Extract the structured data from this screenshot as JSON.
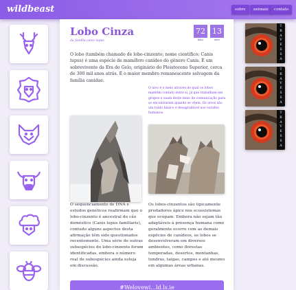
{
  "header": {
    "brand": "wildbeast",
    "nav": [
      "sobre",
      "animais",
      "contato"
    ]
  },
  "rail": {
    "animals": [
      "deer-icon",
      "lion-icon",
      "fox-icon",
      "bull-icon",
      "sheep-icon",
      "bee-icon"
    ]
  },
  "article": {
    "title": "Lobo Cinza",
    "subtitle": "da família canis lupus",
    "stats": [
      {
        "value": "72",
        "label": "kilos"
      },
      {
        "value": "13",
        "label": "anos"
      }
    ],
    "intro": "O lobo (também chamado de lobo-cinzento; nome científico: Canis lupus) é uma espécie de mamífero canídeo do gênero Canis. É um sobrevivente da Era do Gelo, originário do Pleistoceno Superior, cerca de 300 mil anos atrás. É o maior membro remanescente selvagem da família canidae.",
    "quote": "O uivo é o meio através do qual os lobos mantêm contato entre si, já que trabalham em grupos e usam deste meio de comunicação para se encontrarem quando se vêem. Os uivos são um ruído básico e desagradável aos ouvidos humanos.",
    "body_left": "O sequenciamento de DNA e estudos genéticos reafirmam que o lobo-cinzento é ancestral do cão doméstico (Canis lupus familiaris), contudo alguns aspectos desta afirmação têm sido questionados recentemente. Uma série de outras subespécies do lobo-cinzento foram identificadas, embora o número real de subespécies ainda esteja em discussão.",
    "body_right": "Os lobos-cinzentos são tipicamente predadores ápice nos ecossistemas que ocupam. Embora não sejam tão adaptáveis à presença humana como geralmente ocorre com as demais espécies de canídeos, os lobos se desenvolveram em diversos ambientes, como florestas temperadas, desertos, montanhas, tundras, taigas, campos e até mesmo em algumas áreas urbanas.",
    "cta": "#Welovewi...ld.ls.ie"
  },
  "sidebar": {
    "tile_word": [
      "T",
      "R",
      "A",
      "V",
      "E",
      "S",
      "S",
      "A"
    ]
  },
  "colors": {
    "accent": "#8b57d9",
    "header": "#9b6ef0",
    "text": "#3b3346"
  }
}
